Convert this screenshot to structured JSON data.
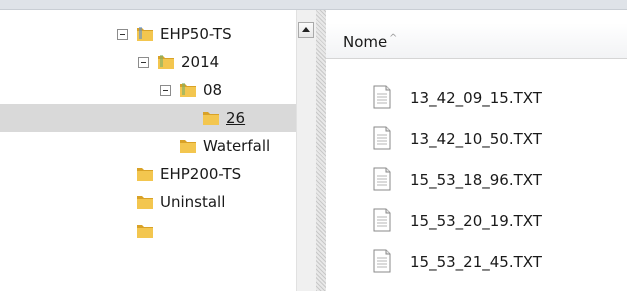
{
  "tree": {
    "items": [
      {
        "label": "EHP50-TS",
        "expanded": true
      },
      {
        "label": "2014",
        "expanded": true
      },
      {
        "label": "08",
        "expanded": true
      },
      {
        "label": "26",
        "selected": true
      },
      {
        "label": "Waterfall"
      },
      {
        "label": "EHP200-TS"
      },
      {
        "label": "Uninstall"
      }
    ]
  },
  "list": {
    "column_header": "Nome",
    "sort_indicator": "^",
    "files": [
      "13_42_09_15.TXT",
      "13_42_10_50.TXT",
      "15_53_18_96.TXT",
      "15_53_20_19.TXT",
      "15_53_21_45.TXT"
    ]
  },
  "colors": {
    "folder": "#e8b43a",
    "selection": "#d9d9d9",
    "header": "#f2f3f5"
  }
}
